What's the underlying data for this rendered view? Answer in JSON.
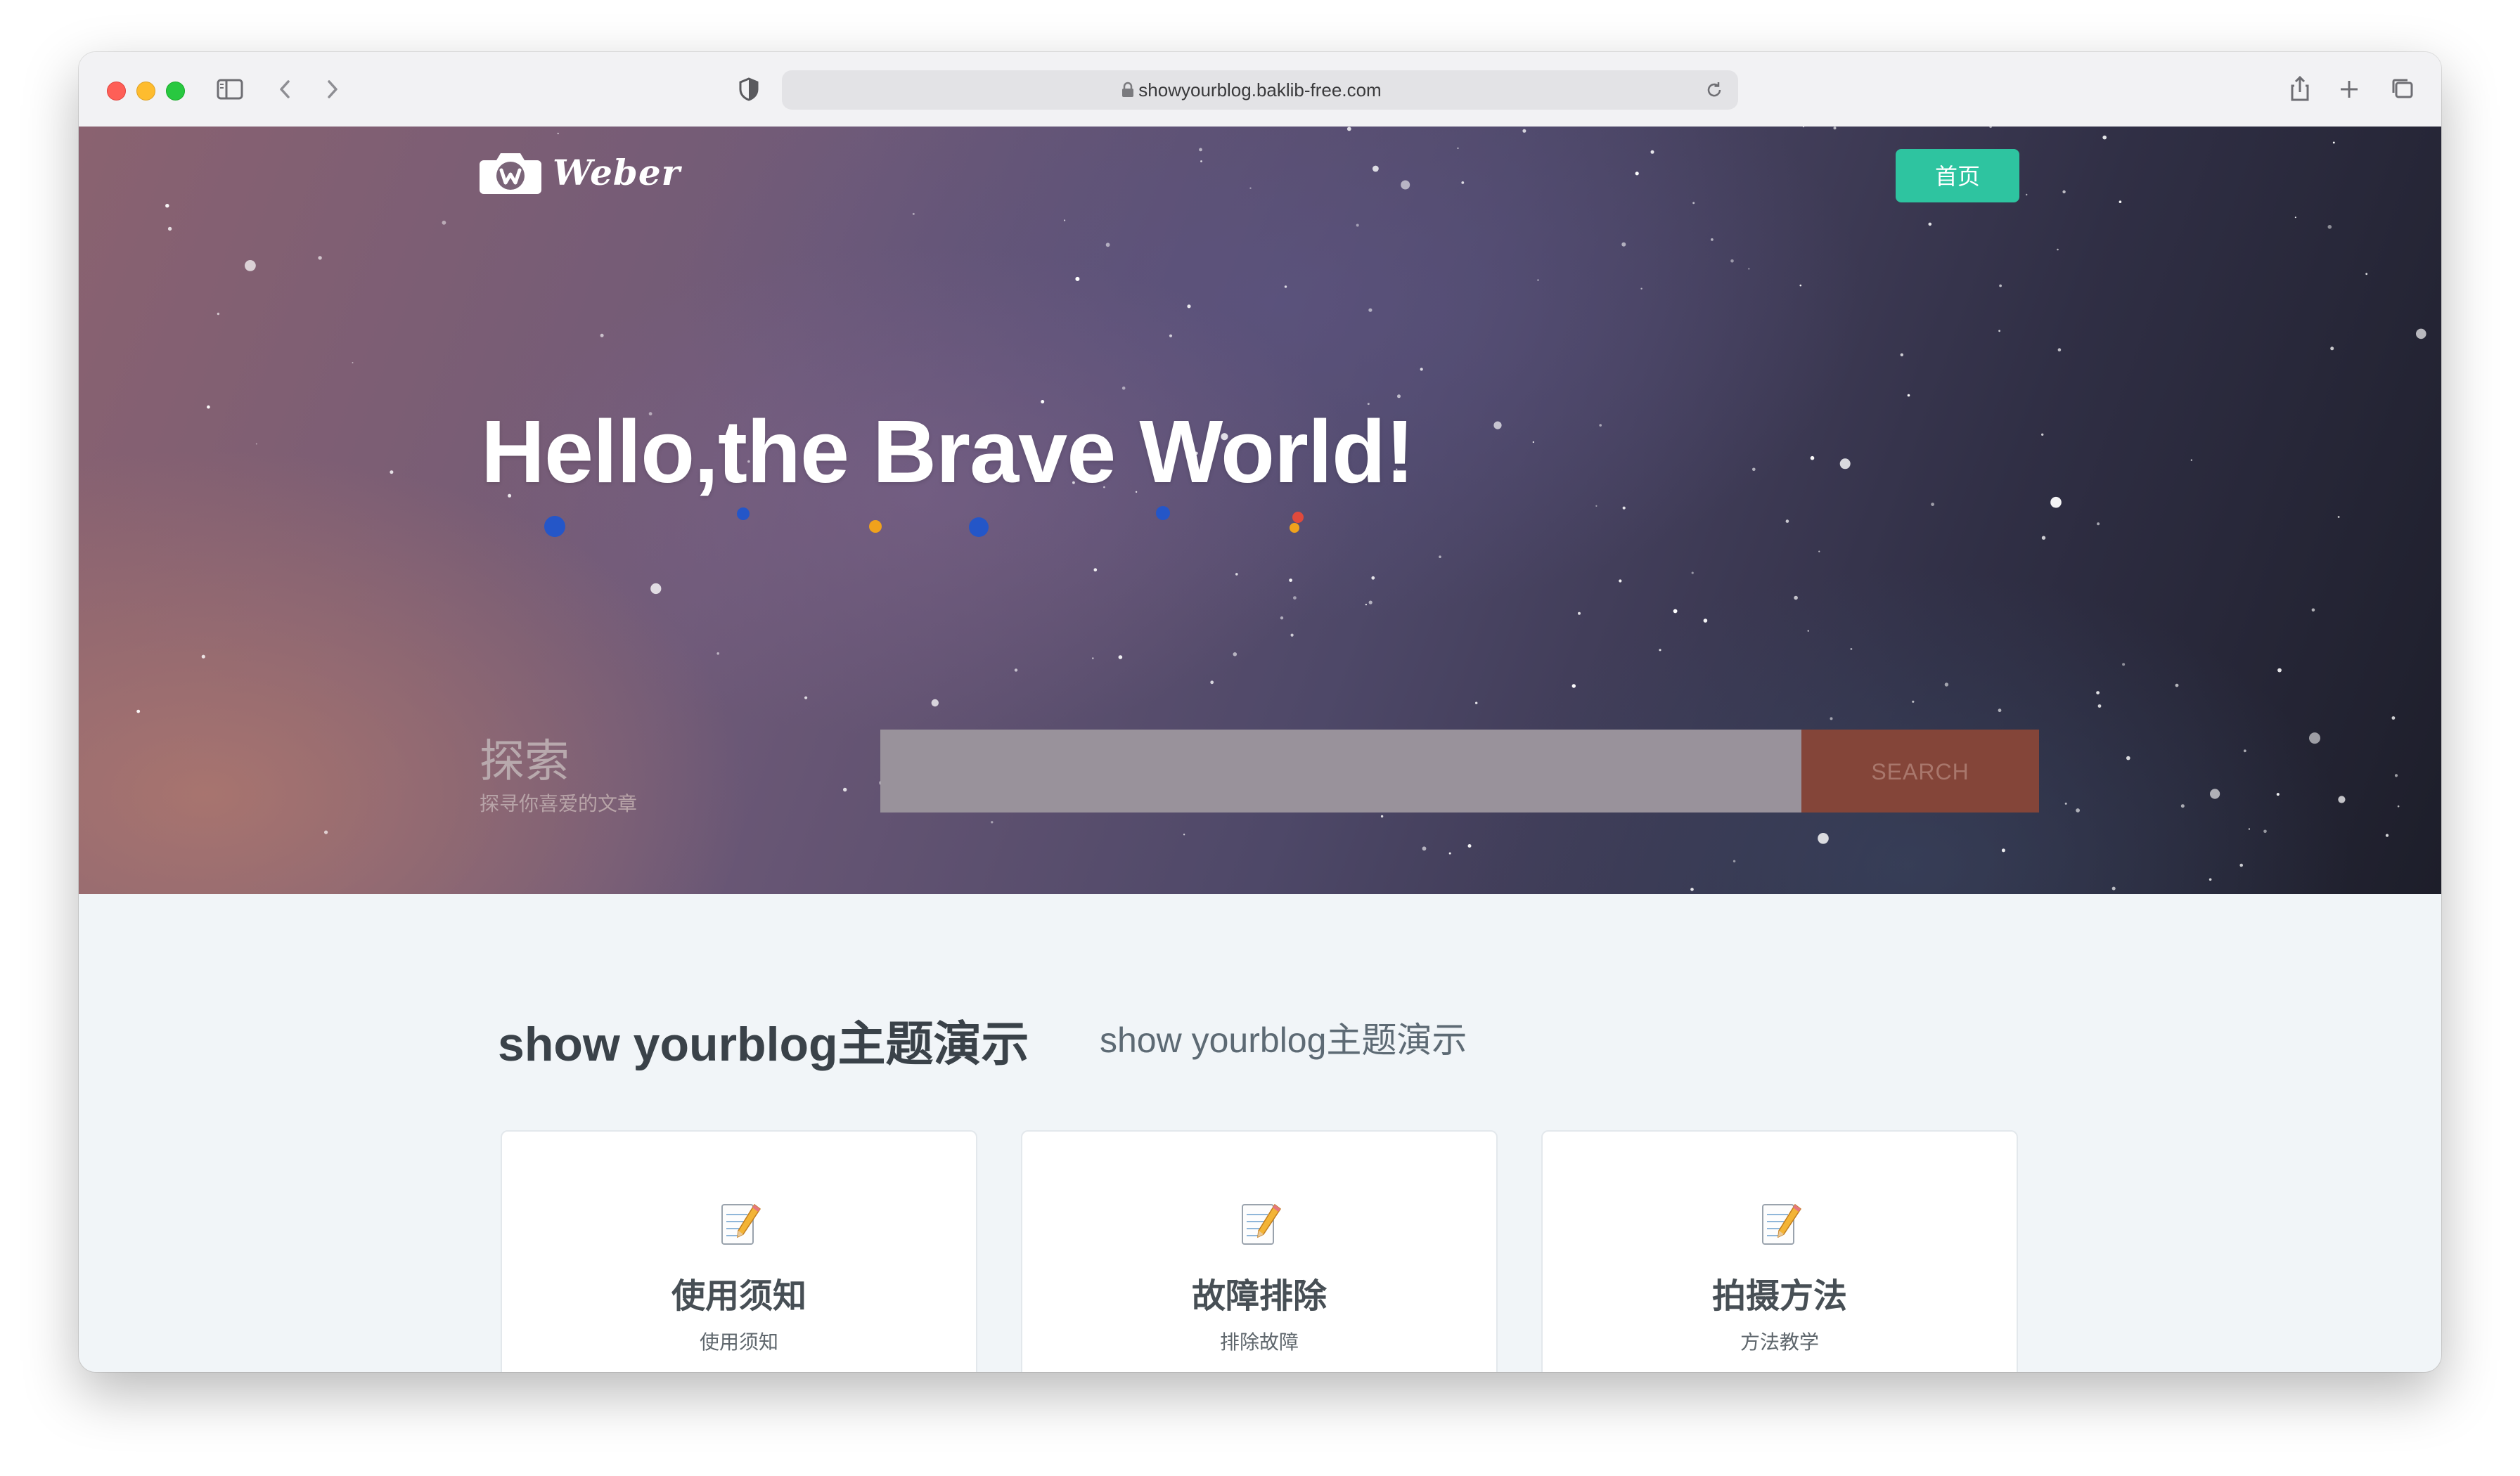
{
  "browser": {
    "url": "showyourblog.baklib-free.com"
  },
  "site": {
    "logo_text": "Weber",
    "nav": {
      "home_label": "首页"
    }
  },
  "hero": {
    "title": "Hello,the Brave World!",
    "explore_title": "探索",
    "explore_subtitle": "探寻你喜爱的文章",
    "search_placeholder": "",
    "search_button": "SEARCH"
  },
  "section": {
    "title": "show yourblog主题演示",
    "subtitle": "show yourblog主题演示"
  },
  "cards": [
    {
      "icon": "memo-icon",
      "title": "使用须知",
      "subtitle": "使用须知"
    },
    {
      "icon": "memo-icon",
      "title": "故障排除",
      "subtitle": "排除故障"
    },
    {
      "icon": "memo-icon",
      "title": "拍摄方法",
      "subtitle": "方法教学"
    }
  ],
  "colors": {
    "accent_green": "#2ec4a0",
    "search_button": "#844539",
    "page_background": "#f1f5f8",
    "heading_text": "#3a4249"
  }
}
